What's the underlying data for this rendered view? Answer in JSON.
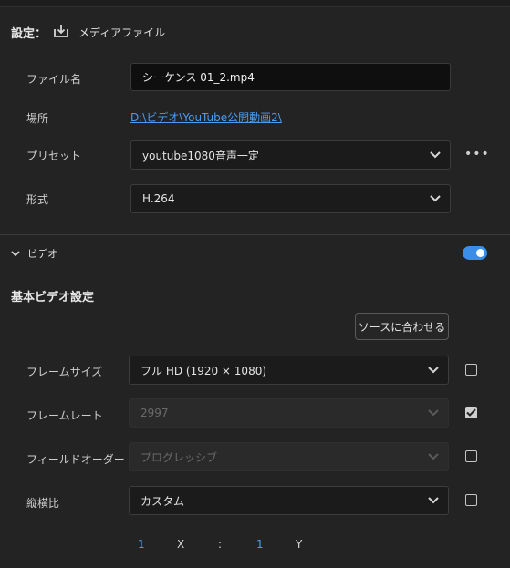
{
  "header": {
    "label": "設定：",
    "title": "メディアファイル"
  },
  "file": {
    "name_label": "ファイル名",
    "name_value": "シーケンス 01_2.mp4",
    "location_label": "場所",
    "location_value": "D:\\ビデオ\\YouTube公開動画2\\",
    "preset_label": "プリセット",
    "preset_value": "youtube1080音声一定",
    "more_label": "•••",
    "format_label": "形式",
    "format_value": "H.264"
  },
  "video": {
    "section_label": "ビデオ",
    "toggle_on": true,
    "basic_title": "基本ビデオ設定",
    "match_source_label": "ソースに合わせる",
    "frame_size_label": "フレームサイズ",
    "frame_size_value": "フル HD (1920 × 1080)",
    "frame_size_checked": false,
    "frame_rate_label": "フレームレート",
    "frame_rate_value": "2997",
    "frame_rate_checked": true,
    "field_order_label": "フィールドオーダー",
    "field_order_value": "プログレッシブ",
    "field_order_checked": false,
    "aspect_label": "縦横比",
    "aspect_value": "カスタム",
    "aspect_checked": false,
    "aspect_ratio": {
      "x_value": "1",
      "x_label": "X",
      "separator": ":",
      "y_value": "1",
      "y_label": "Y"
    }
  },
  "colors": {
    "accent": "#3b8ee8",
    "link": "#4b9cf0",
    "background": "#232323"
  }
}
